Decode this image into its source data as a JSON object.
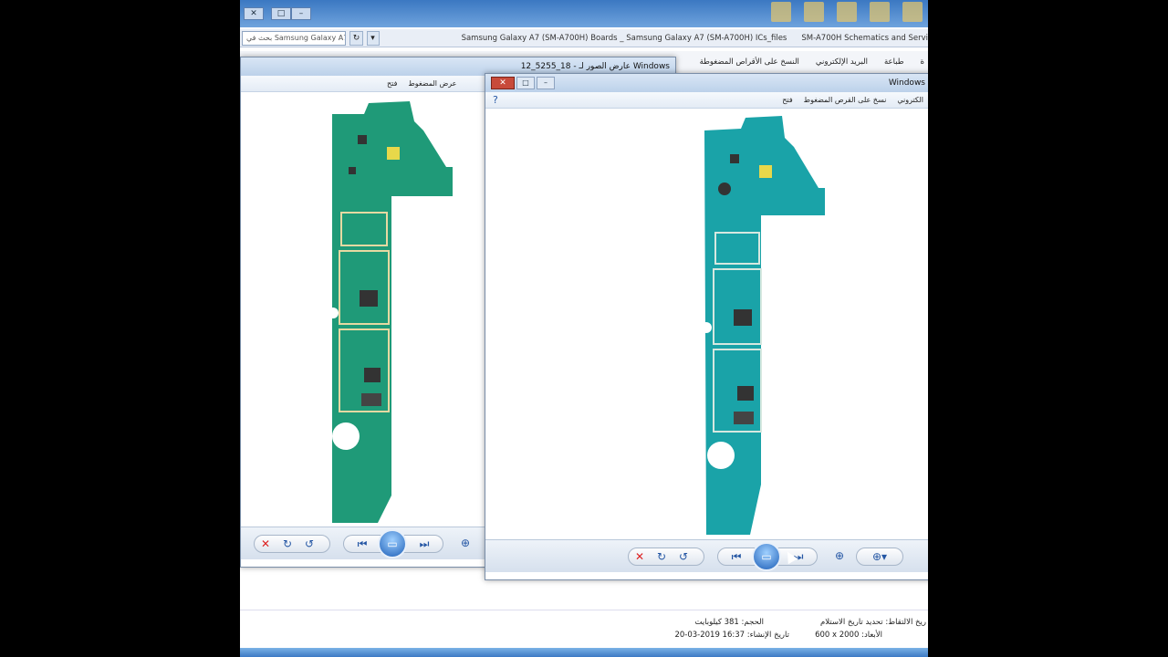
{
  "background_window": {
    "search_placeholder": "بحث في Samsung Galaxy A7 (S...",
    "tab_1": "Samsung Galaxy A7 (SM-A700H) Boards _ Samsung Galaxy A7 (SM-A700H) ICs_files",
    "tab_2": "SM-A700H Schematics and Servi",
    "menu": [
      "ة",
      "طباعة",
      "البريد الإلكتروني",
      "النسخ على الأقراص المضغوطة"
    ]
  },
  "left_viewer": {
    "title": "12_5255_18 - عارض الصور لـ Windows",
    "toolbar": [
      "فتح",
      "عرض المضغوط"
    ]
  },
  "right_viewer": {
    "title": "Windows",
    "toolbar": [
      "فتح",
      "نسخ على القرص المضغوط",
      "الكتروني"
    ]
  },
  "details": {
    "date_taken_label": "ريخ الالتقاط:",
    "date_taken_value": "تحديد تاريخ الاستلام",
    "dimensions_label": "الأبعاد:",
    "dimensions_value": "600 x 2000",
    "size_label": "الحجم:",
    "size_value": "381 كيلوبايت",
    "created_label": "تاريخ الإنشاء:",
    "created_value": "20-03-2019 16:37"
  },
  "colors": {
    "pcb_left": "#1f9a78",
    "pcb_right": "#1aa3a8"
  }
}
